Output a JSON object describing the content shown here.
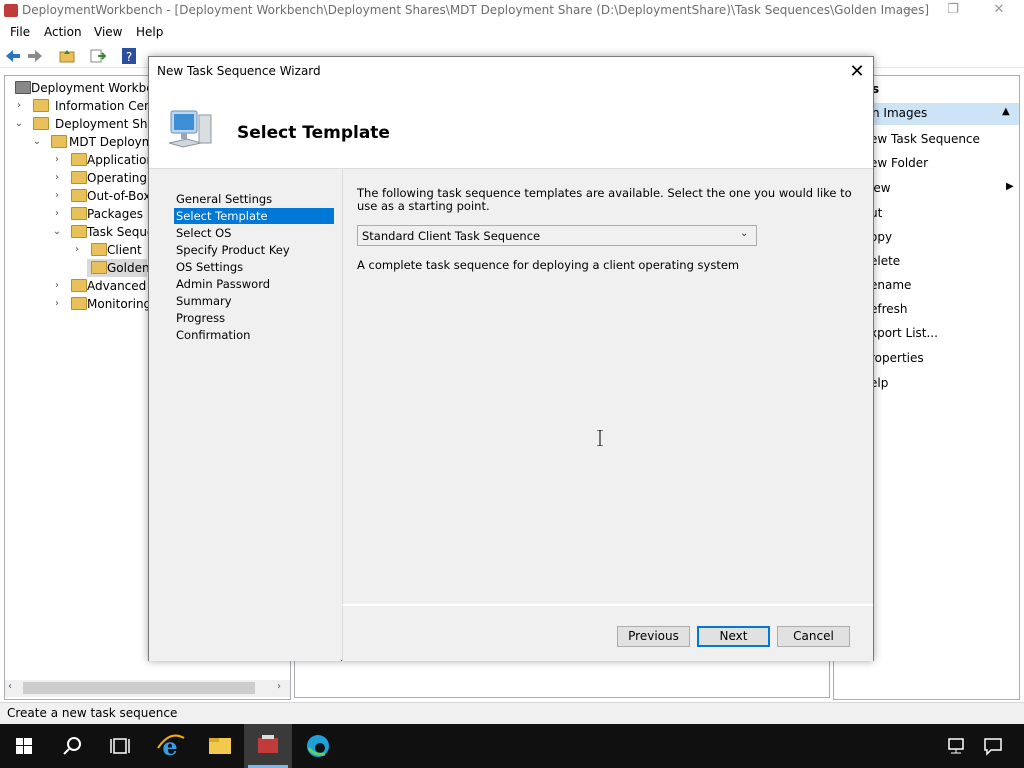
{
  "window": {
    "title": "DeploymentWorkbench - [Deployment Workbench\\Deployment Shares\\MDT Deployment Share (D:\\DeploymentShare)\\Task Sequences\\Golden Images]",
    "minimize": "—",
    "restore": "❐",
    "close": "✕"
  },
  "menu": [
    "File",
    "Action",
    "View",
    "Help"
  ],
  "tree": {
    "items": [
      {
        "label": "Deployment Workbenc",
        "level": 0,
        "expander": ""
      },
      {
        "label": "Information Center",
        "level": 1,
        "expander": "›"
      },
      {
        "label": "Deployment Shares",
        "level": 1,
        "expander": "⌄"
      },
      {
        "label": "MDT Deployme",
        "level": 2,
        "expander": "⌄"
      },
      {
        "label": "Application",
        "level": 3,
        "expander": "›"
      },
      {
        "label": "Operating S",
        "level": 3,
        "expander": "›"
      },
      {
        "label": "Out-of-Box",
        "level": 3,
        "expander": "›"
      },
      {
        "label": "Packages",
        "level": 3,
        "expander": "›"
      },
      {
        "label": "Task Sequer",
        "level": 3,
        "expander": "⌄"
      },
      {
        "label": "Client",
        "level": 4,
        "expander": "›"
      },
      {
        "label": "Golden",
        "level": 4,
        "expander": ""
      },
      {
        "label": "Advanced C",
        "level": 3,
        "expander": "›"
      },
      {
        "label": "Monitoring",
        "level": 3,
        "expander": "›"
      }
    ]
  },
  "actions": {
    "header": "s",
    "section": "n Images",
    "items": [
      "ew Task Sequence",
      "ew Folder",
      "iew",
      "ut",
      "opy",
      "elete",
      "ename",
      "efresh",
      "xport List...",
      "roperties",
      "elp"
    ]
  },
  "status": "Create a new task sequence",
  "dialog": {
    "title": "New Task Sequence Wizard",
    "close": "✕",
    "heading": "Select Template",
    "nav": [
      "General Settings",
      "Select Template",
      "Select OS",
      "Specify Product Key",
      "OS Settings",
      "Admin Password",
      "Summary",
      "Progress",
      "Confirmation"
    ],
    "active_nav": "Select Template",
    "description": "The following task sequence templates are available.  Select the one you would like to use as a starting point.",
    "template_selected": "Standard Client Task Sequence",
    "template_description": "A complete task sequence for deploying a client operating system",
    "buttons": {
      "previous": "Previous",
      "next": "Next",
      "cancel": "Cancel"
    }
  },
  "colors": {
    "selection": "#0078d7",
    "taskbar": "#101010"
  }
}
